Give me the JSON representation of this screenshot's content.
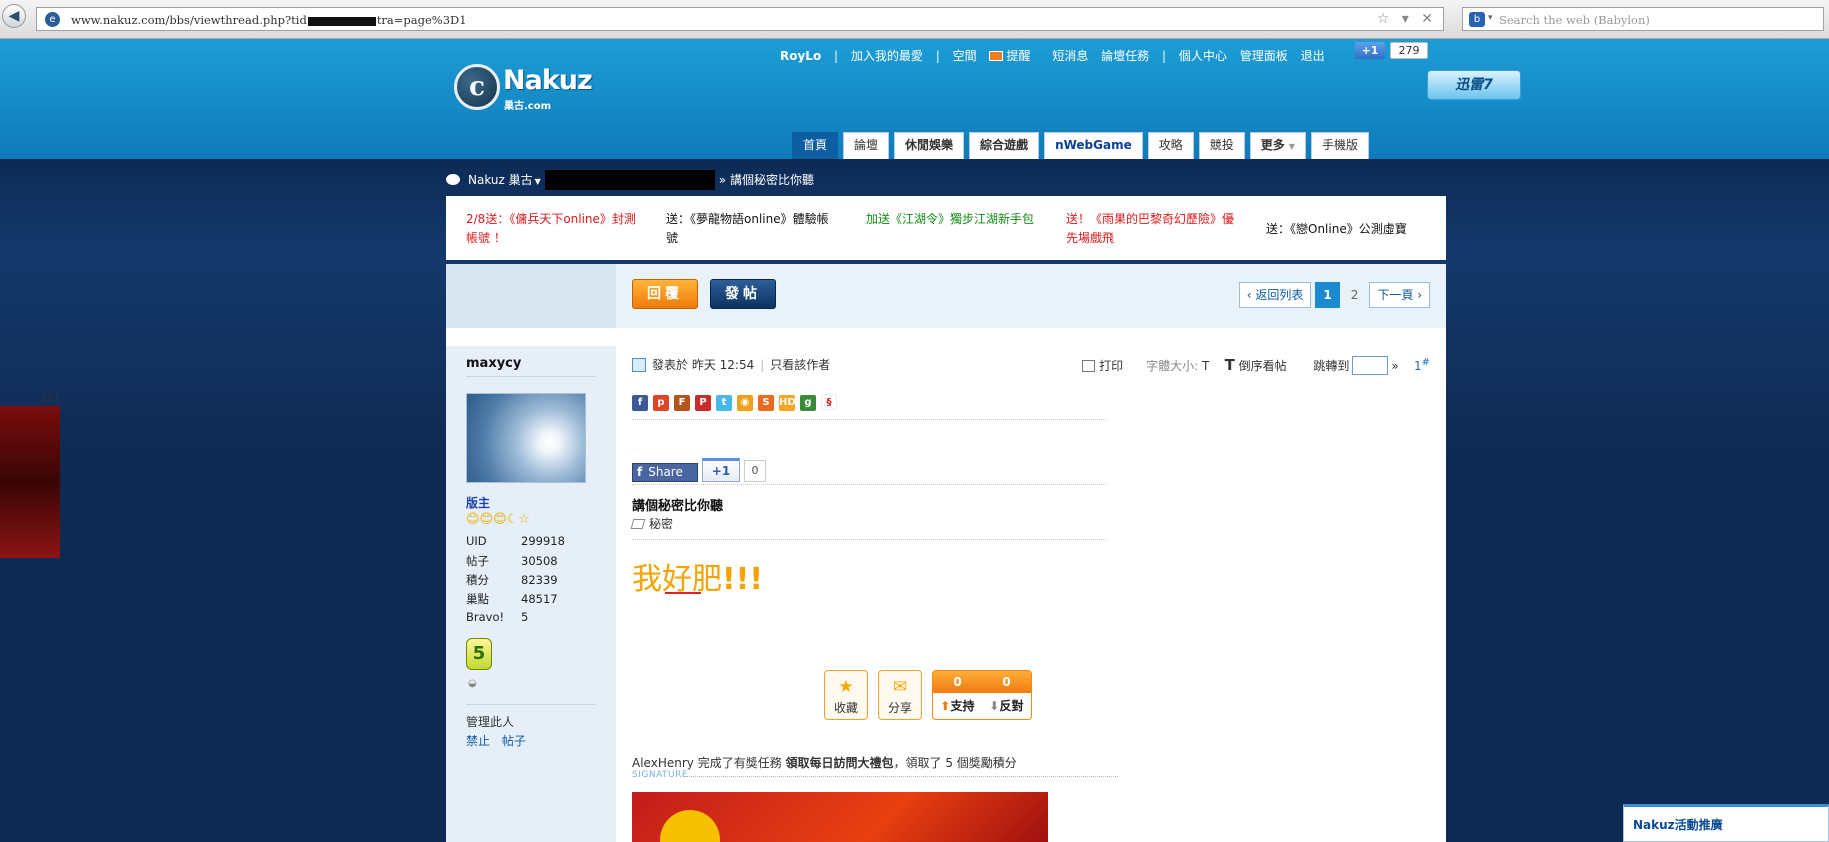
{
  "browser": {
    "url_prefix": "www.nakuz.com/bbs/viewthread.php?tid",
    "url_suffix": "tra=page%3D1",
    "search_placeholder": "Search the web (Babylon)",
    "url_icons": "☆ ▾ ✕"
  },
  "header": {
    "logo_text": "Nakuz",
    "logo_sub": "巢古.com",
    "top_links": {
      "user": "RoyLo",
      "add_favorite": "加入我的最愛",
      "space": "空間",
      "reminder": "提醒",
      "messages": "短消息",
      "tasks": "論壇任務",
      "personal_center": "個人中心",
      "admin_panel": "管理面板",
      "logout": "退出"
    },
    "gplus_label": "+1",
    "gplus_count": "279",
    "xunlei_label": "迅雷7",
    "nav_tabs": [
      {
        "label": "首頁"
      },
      {
        "label": "論壇"
      },
      {
        "label": "休閒娛樂"
      },
      {
        "label": "綜合遊戲"
      },
      {
        "label": "nWebGame"
      },
      {
        "label": "攻略"
      },
      {
        "label": "競投"
      },
      {
        "label": "更多"
      },
      {
        "label": "手機版"
      }
    ]
  },
  "breadcrumb": {
    "site": "Nakuz 巢古",
    "thread": "» 講個秘密比你聽"
  },
  "announcements": [
    {
      "text": "2/8送：《傭兵天下online》封測帳號 ！"
    },
    {
      "text": "送：《夢龍物語online》體驗帳號"
    },
    {
      "text": "加送《江湖令》獨步江湖新手包"
    },
    {
      "text": "送！《雨果的巴黎奇幻歷險》優先場戲飛"
    },
    {
      "text": "送：《戀Online》公測虛寶"
    }
  ],
  "buttons": {
    "reply": "回覆",
    "new_post": "發帖"
  },
  "pager": {
    "back": "‹ 返回列表",
    "page1": "1",
    "page2": "2",
    "next": "下一頁 ›"
  },
  "user": {
    "name": "maxycy",
    "role": "版主",
    "medals": "😊😊😊☾☆",
    "stats": [
      {
        "k": "UID",
        "v": "299918"
      },
      {
        "k": "帖子",
        "v": "30508"
      },
      {
        "k": "積分",
        "v": "82339"
      },
      {
        "k": "巢點",
        "v": "48517"
      },
      {
        "k": "Bravo!",
        "v": "5"
      }
    ],
    "level": "5",
    "manage_label": "管理此人",
    "ban": "禁止",
    "posts": "帖子"
  },
  "post": {
    "posted_at": "發表於 昨天 12:54",
    "only_author": "只看該作者",
    "print": "打印",
    "font_size_label": "字體大小:",
    "font_size_t": "T",
    "reverse": "倒序看帖",
    "jump_to": "跳轉到",
    "jump_arrow": "»",
    "floor": "1",
    "floor_mark": "#",
    "fb_share": "Share",
    "fb_f": "f",
    "gplus_small": "+1",
    "gplus_small_count": "0",
    "title": "講個秘密比你聽",
    "tag": "秘密",
    "body_text": "我好肥",
    "body_bang": "!!!",
    "fav": "收藏",
    "share": "分享",
    "support_count": "0",
    "oppose_count": "0",
    "support": "支持",
    "oppose": "反對",
    "task_user": "AlexHenry",
    "task_mid": " 完成了有獎任務 ",
    "task_name": "領取每日訪問大禮包",
    "task_end": "，領取了 5 個獎勵積分",
    "signature_label": "SIGNATURE"
  },
  "side": {
    "close": "[X]",
    "promo": "Nakuz活動推廣"
  }
}
